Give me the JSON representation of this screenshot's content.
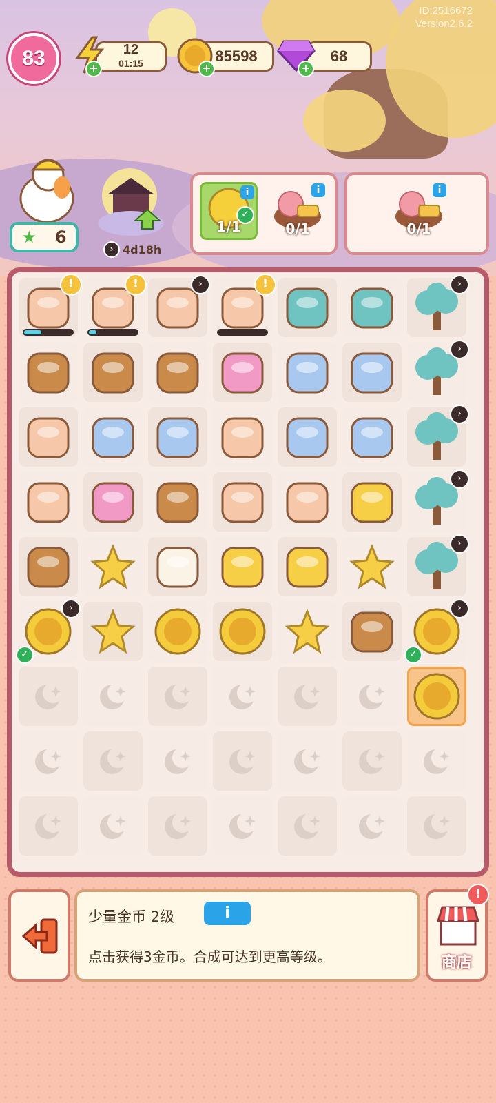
{
  "version": {
    "id": "ID:2516672",
    "label": "Version2.6.2"
  },
  "hud": {
    "level": "83",
    "energy": "12",
    "energy_timer": "01:15",
    "coins": "85598",
    "gems": "68"
  },
  "side": {
    "stars": "6",
    "event_timer": "4d18h"
  },
  "orders": [
    {
      "slots": [
        {
          "count": "1/1",
          "done": true,
          "item": "gold-coin-icon"
        },
        {
          "count": "0/1",
          "done": false,
          "item": "mooncake-basket-icon"
        }
      ]
    },
    {
      "slots": [
        {
          "count": "0/1",
          "done": false,
          "item": "mooncake-basket-icon"
        }
      ]
    }
  ],
  "board_rows": [
    [
      "tea-pot-icon",
      "bunny-worker-icon",
      "bunny-mortar-icon",
      "bunny-pestle-icon",
      "jade-tray-icon",
      "jade-tray-icon",
      "moon-tree-icon"
    ],
    [
      "loom-icon",
      "loom-icon",
      "loom-icon",
      "pink-cloth-icon",
      "lucky-bag-icon",
      "lucky-bag-icon",
      "moon-tree-icon"
    ],
    [
      "osmanthus-tea-icon",
      "blue-cup-icon",
      "lantern-jar-icon",
      "bunny-cake-icon",
      "glass-teacup-icon",
      "honey-jar-icon",
      "moon-tree-icon"
    ],
    [
      "pagoda-icon",
      "infinity-gem-icon",
      "mooncake-icon",
      "lantern-box-icon",
      "osmanthus-branch-icon",
      "osmanthus-flower-icon",
      "moon-tree-icon"
    ],
    [
      "twig-icon",
      "star-plate-icon",
      "cloud-icon",
      "flower-petal-icon",
      "small-petal-icon",
      "star-basket-icon",
      "blossom-tree-icon"
    ],
    [
      "gold-coin-big-icon",
      "star-icon",
      "coin-pile-icon",
      "coin-stack-icon",
      "double-star-icon",
      "piggy-bank-icon",
      "gold-coin-big-icon"
    ],
    [
      "empty",
      "empty",
      "empty",
      "empty",
      "empty",
      "empty",
      "coin-pair-icon"
    ],
    [
      "empty",
      "empty",
      "empty",
      "empty",
      "empty",
      "empty",
      "empty"
    ],
    [
      "empty",
      "empty",
      "empty",
      "empty",
      "empty",
      "empty",
      "empty"
    ]
  ],
  "info_panel": {
    "title": "少量金币 2级",
    "button": "i",
    "desc": "点击获得3金币。合成可达到更高等级。"
  },
  "shop": {
    "label": "商店"
  },
  "colors": {
    "accent": "#f06a9b",
    "board": "#b85a6a",
    "info": "#2aa3e8"
  }
}
